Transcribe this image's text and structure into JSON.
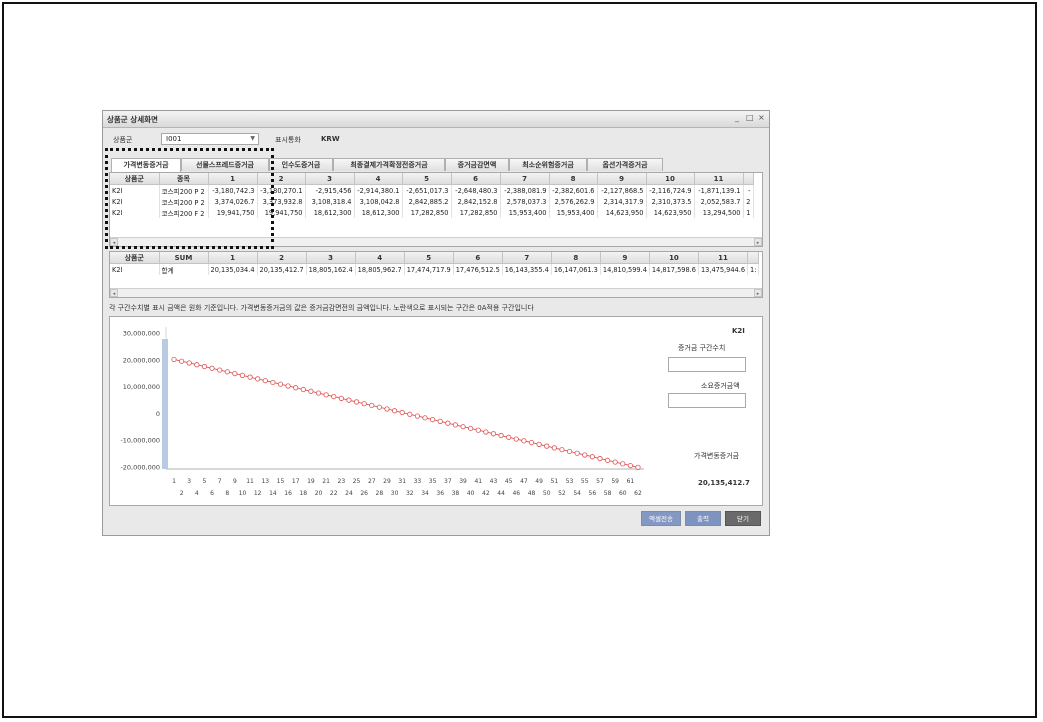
{
  "window": {
    "title": "상품군 상세화면",
    "controls": [
      "_",
      "□",
      "×"
    ]
  },
  "filter": {
    "group_label": "상품군",
    "group_value": "I001",
    "currency_label": "표시통화",
    "currency_value": "KRW"
  },
  "tabs": [
    "가격변동증거금",
    "선물스프레드증거금",
    "인수도증거금",
    "최종결제가격확정전증거금",
    "증거금감면액",
    "최소순위험증거금",
    "옵션가격증거금"
  ],
  "detail_table": {
    "headers": [
      "상품군",
      "종목",
      "1",
      "2",
      "3",
      "4",
      "5",
      "6",
      "7",
      "8",
      "9",
      "10",
      "11",
      ""
    ],
    "rows": [
      [
        "K2I",
        "코스피200 P 2",
        "-3,180,742.3",
        "-3,180,270.1",
        "-2,915,456",
        "-2,914,380.1",
        "-2,651,017.3",
        "-2,648,480.3",
        "-2,388,081.9",
        "-2,382,601.6",
        "-2,127,868.5",
        "-2,116,724.9",
        "-1,871,139.1",
        "-"
      ],
      [
        "K2I",
        "코스피200 P 2",
        "3,374,026.7",
        "3,373,932.8",
        "3,108,318.4",
        "3,108,042.8",
        "2,842,885.2",
        "2,842,152.8",
        "2,578,037.3",
        "2,576,262.9",
        "2,314,317.9",
        "2,310,373.5",
        "2,052,583.7",
        "2"
      ],
      [
        "K2I",
        "코스피200 F 2",
        "19,941,750",
        "19,941,750",
        "18,612,300",
        "18,612,300",
        "17,282,850",
        "17,282,850",
        "15,953,400",
        "15,953,400",
        "14,623,950",
        "14,623,950",
        "13,294,500",
        "1"
      ]
    ]
  },
  "sum_table": {
    "headers": [
      "상품군",
      "SUM",
      "1",
      "2",
      "3",
      "4",
      "5",
      "6",
      "7",
      "8",
      "9",
      "10",
      "11",
      ""
    ],
    "rows": [
      [
        "K2I",
        "합계",
        "20,135,034.4",
        "20,135,412.7",
        "18,805,162.4",
        "18,805,962.7",
        "17,474,717.9",
        "17,476,512.5",
        "16,143,355.4",
        "16,147,061.3",
        "14,810,599.4",
        "14,817,598.6",
        "13,475,944.6",
        "1:"
      ]
    ]
  },
  "note": "각 구간수치별 표시 금액은 원화 기준입니다.    가격변동증거금의 값은 증거금감면전의 금액입니다.    노란색으로 표시되는 구간은 0A적용 구간입니다",
  "side": {
    "group": "K2I",
    "interval_label": "증거금 구간수치",
    "interval_value": "",
    "required_label": "소요증거금액",
    "required_value": "",
    "margin_label": "가격변동증거금",
    "margin_value": "20,135,412.7"
  },
  "buttons": {
    "excel": "엑셀전송",
    "print": "출력",
    "close": "닫기"
  },
  "colors": {
    "line": "#e05050",
    "bar": "#b9cbe3",
    "btn_blue": "#7f95bf",
    "btn_gray": "#6e6e6e"
  },
  "chart_data": {
    "type": "line",
    "y_ticks": [
      "30,000,000",
      "20,000,000",
      "10,000,000",
      "0",
      "-10,000,000",
      "-20,000,000"
    ],
    "ylim": [
      -20000000,
      30000000
    ],
    "x_odd": [
      "1",
      "3",
      "5",
      "7",
      "9",
      "11",
      "13",
      "15",
      "17",
      "19",
      "21",
      "23",
      "25",
      "27",
      "29",
      "31",
      "33",
      "35",
      "37",
      "39",
      "41",
      "43",
      "45",
      "47",
      "49",
      "51",
      "53",
      "55",
      "57",
      "59",
      "61"
    ],
    "x_even": [
      "2",
      "4",
      "6",
      "8",
      "10",
      "12",
      "14",
      "16",
      "18",
      "20",
      "22",
      "24",
      "26",
      "28",
      "30",
      "32",
      "34",
      "36",
      "38",
      "40",
      "42",
      "44",
      "46",
      "48",
      "50",
      "52",
      "54",
      "56",
      "58",
      "60",
      "62"
    ],
    "series": [
      {
        "x_start": 1,
        "x_end": 62,
        "y_start": 20135000,
        "y_end": -20135000
      }
    ]
  }
}
